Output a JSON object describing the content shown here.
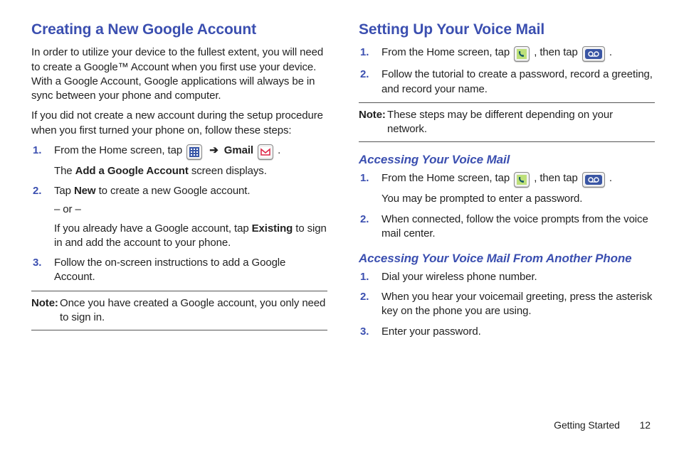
{
  "left": {
    "heading": "Creating a New Google Account",
    "p1": "In order to utilize your device to the fullest extent, you will need to create a Google™ Account when you first use your device. With a Google Account, Google applications will always be in sync between your phone and computer.",
    "p2": "If you did not create a new account during the setup procedure when you first turned your phone on, follow these steps:",
    "steps": [
      {
        "n": "1.",
        "a": "From the Home screen, tap ",
        "b": " ➔ ",
        "c": "Gmail",
        "d": " .",
        "sub": "The ",
        "sub_b": "Add a Google Account",
        "sub_c": " screen displays."
      },
      {
        "n": "2.",
        "a": "Tap ",
        "b": "New",
        "c": " to create a new Google account.",
        "or": "– or –",
        "d": "If you already have a Google account, tap ",
        "e": "Existing",
        "f": " to sign in and add the account to your phone."
      },
      {
        "n": "3.",
        "a": "Follow the on-screen instructions to add a Google Account."
      }
    ],
    "note_label": "Note:",
    "note_text": "Once you have created a Google account, you only need to sign in."
  },
  "right": {
    "heading": "Setting Up Your Voice Mail",
    "steps1": [
      {
        "n": "1.",
        "a": "From the Home screen, tap ",
        "b": ", then tap ",
        "c": " ."
      },
      {
        "n": "2.",
        "a": "Follow the tutorial to create a password, record a greeting, and record your name."
      }
    ],
    "note_label": "Note:",
    "note_text": "These steps may be different depending on your network.",
    "sub1": "Accessing Your Voice Mail",
    "steps2": [
      {
        "n": "1.",
        "a": "From the Home screen, tap ",
        "b": ", then tap ",
        "c": " .",
        "sub": "You may be prompted to enter a password."
      },
      {
        "n": "2.",
        "a": "When connected, follow the voice prompts from the voice mail center."
      }
    ],
    "sub2": "Accessing Your Voice Mail From Another Phone",
    "steps3": [
      {
        "n": "1.",
        "a": "Dial your wireless phone number."
      },
      {
        "n": "2.",
        "a": "When you hear your voicemail greeting, press the asterisk key on the phone you are using."
      },
      {
        "n": "3.",
        "a": "Enter your password."
      }
    ]
  },
  "footer": {
    "section": "Getting Started",
    "page": "12"
  }
}
